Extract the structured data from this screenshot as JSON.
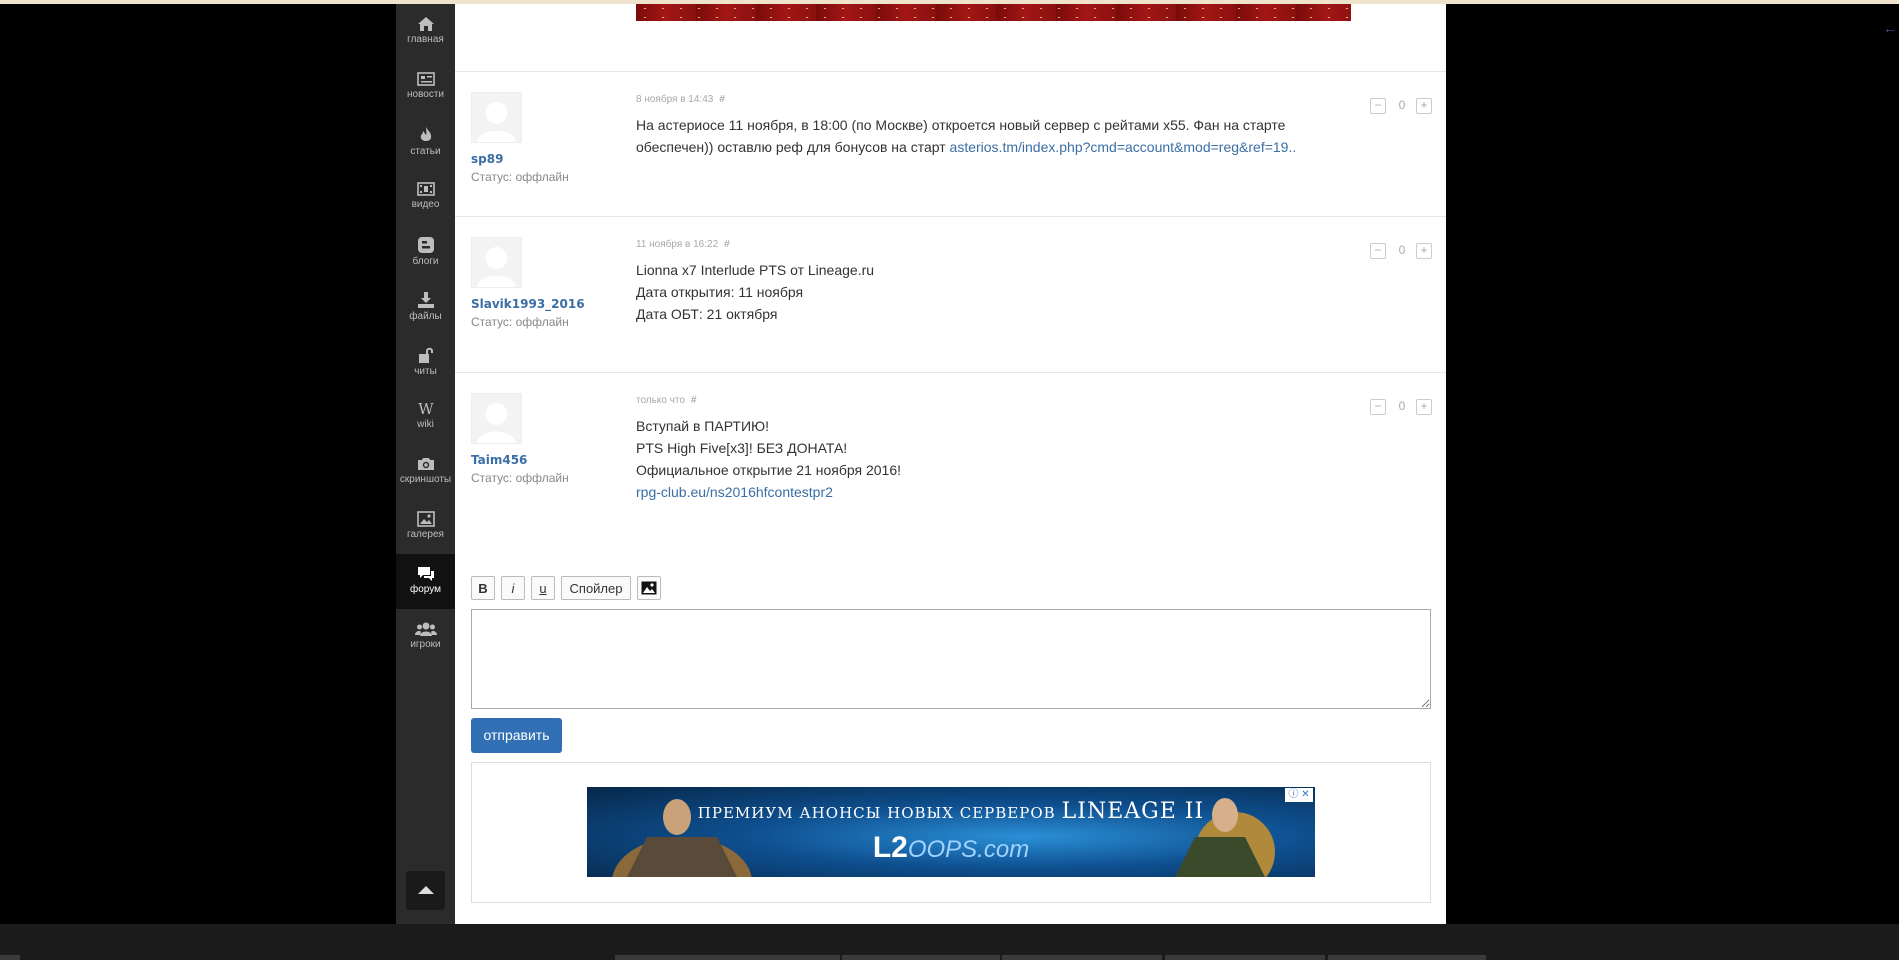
{
  "sidebar": {
    "items": [
      {
        "label": "главная",
        "icon": "home-icon"
      },
      {
        "label": "новости",
        "icon": "newspaper-icon"
      },
      {
        "label": "статьи",
        "icon": "fire-icon"
      },
      {
        "label": "видео",
        "icon": "film-icon"
      },
      {
        "label": "блоги",
        "icon": "blog-icon"
      },
      {
        "label": "файлы",
        "icon": "download-icon"
      },
      {
        "label": "читы",
        "icon": "unlock-icon"
      },
      {
        "label": "wiki",
        "icon": "wiki-icon"
      },
      {
        "label": "скриншоты",
        "icon": "camera-icon"
      },
      {
        "label": "галерея",
        "icon": "picture-icon"
      },
      {
        "label": "форум",
        "icon": "chat-icon"
      },
      {
        "label": "игроки",
        "icon": "users-icon"
      }
    ],
    "active": "форум"
  },
  "comments": [
    {
      "user": "sp89",
      "status": "Статус: оффлайн",
      "date": "8 ноября в 14:43",
      "hash": "#",
      "votes": "0",
      "text_lines": [
        "На астериосе 11 ноября, в 18:00 (по Москве) откроется новый сервер с рейтами х55. Фан на старте",
        "обеспечен)) оставлю реф для бонусов на старт "
      ],
      "link": "asterios.tm/index.php?cmd=account&mod=reg&ref=19.."
    },
    {
      "user": "Slavik1993_2016",
      "status": "Статус: оффлайн",
      "date": "11 ноября в 16:22",
      "hash": "#",
      "votes": "0",
      "text_lines": [
        "Lionna x7 Interlude PTS от Lineage.ru",
        "Дата открытия: 11 ноября",
        "Дата ОБТ: 21 октября"
      ]
    },
    {
      "user": "Taim456",
      "status": "Статус: оффлайн",
      "date": "только что",
      "hash": "#",
      "votes": "0",
      "text_lines": [
        "Вступай в ПАРТИЮ!",
        "PTS High Five[x3]! БЕЗ ДОНАТА!",
        "Официальное открытие 21 ноября 2016!"
      ],
      "link": "rpg-club.eu/ns2016hfcontestpr2"
    }
  ],
  "editor": {
    "bold": "B",
    "italic": "i",
    "underline": "u",
    "spoiler": "Спойлер",
    "image_icon": "image-icon",
    "value": ""
  },
  "send_label": "отправить",
  "ad": {
    "title": "ПРЕМИУМ АНОНСЫ НОВЫХ СЕРВЕРОВ",
    "title_big": "LINEAGE II",
    "logo_bold": "L2",
    "logo_light": "OOPS.com",
    "info_icon": "info-icon",
    "close_icon": "close-icon"
  },
  "colors": {
    "accent": "#3270b5",
    "link": "#3a6ea5",
    "sidebar": "#2b2b2b"
  }
}
